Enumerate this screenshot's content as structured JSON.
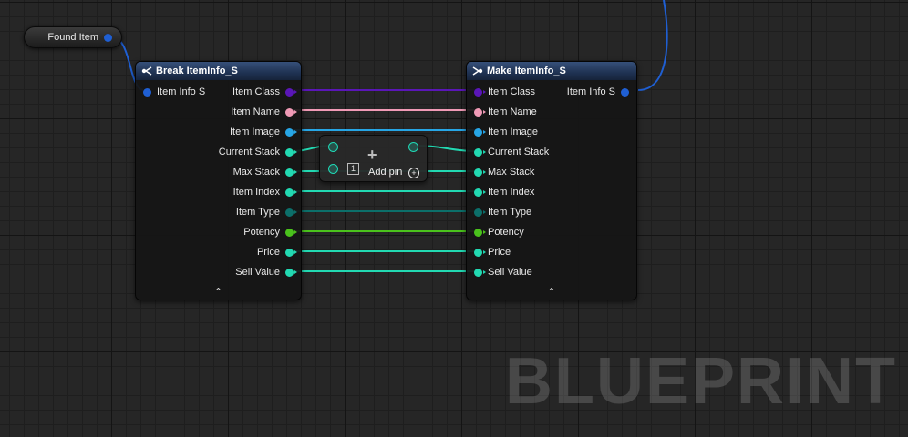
{
  "found_item": {
    "label": "Found Item",
    "pin_color": "#1f5fd3"
  },
  "break_node": {
    "title": "Break ItemInfo_S",
    "input_label": "Item Info S",
    "outputs": [
      {
        "label": "Item Class",
        "color": "#5a16b8"
      },
      {
        "label": "Item Name",
        "color": "#f09ab6"
      },
      {
        "label": "Item Image",
        "color": "#27a6e6"
      },
      {
        "label": "Current Stack",
        "color": "#22d9b2"
      },
      {
        "label": "Max Stack",
        "color": "#22d9b2"
      },
      {
        "label": "Item Index",
        "color": "#22d9b2"
      },
      {
        "label": "Item Type",
        "color": "#0c6f6a"
      },
      {
        "label": "Potency",
        "color": "#4ac21c"
      },
      {
        "label": "Price",
        "color": "#22d9b2"
      },
      {
        "label": "Sell Value",
        "color": "#22d9b2"
      }
    ]
  },
  "make_node": {
    "title": "Make ItemInfo_S",
    "output_label": "Item Info S",
    "inputs": [
      {
        "label": "Item Class",
        "color": "#5a16b8"
      },
      {
        "label": "Item Name",
        "color": "#f09ab6"
      },
      {
        "label": "Item Image",
        "color": "#27a6e6"
      },
      {
        "label": "Current Stack",
        "color": "#22d9b2"
      },
      {
        "label": "Max Stack",
        "color": "#22d9b2"
      },
      {
        "label": "Item Index",
        "color": "#22d9b2"
      },
      {
        "label": "Item Type",
        "color": "#0c6f6a"
      },
      {
        "label": "Potency",
        "color": "#4ac21c"
      },
      {
        "label": "Price",
        "color": "#22d9b2"
      },
      {
        "label": "Sell Value",
        "color": "#22d9b2"
      }
    ]
  },
  "add_node": {
    "label": "Add pin",
    "index_badge": "1",
    "plus": "+",
    "add_icon": "+"
  },
  "collapse_glyph": "⌃",
  "watermark": "BLUEPRINT",
  "struct_pin_color": "#1f5fd3"
}
